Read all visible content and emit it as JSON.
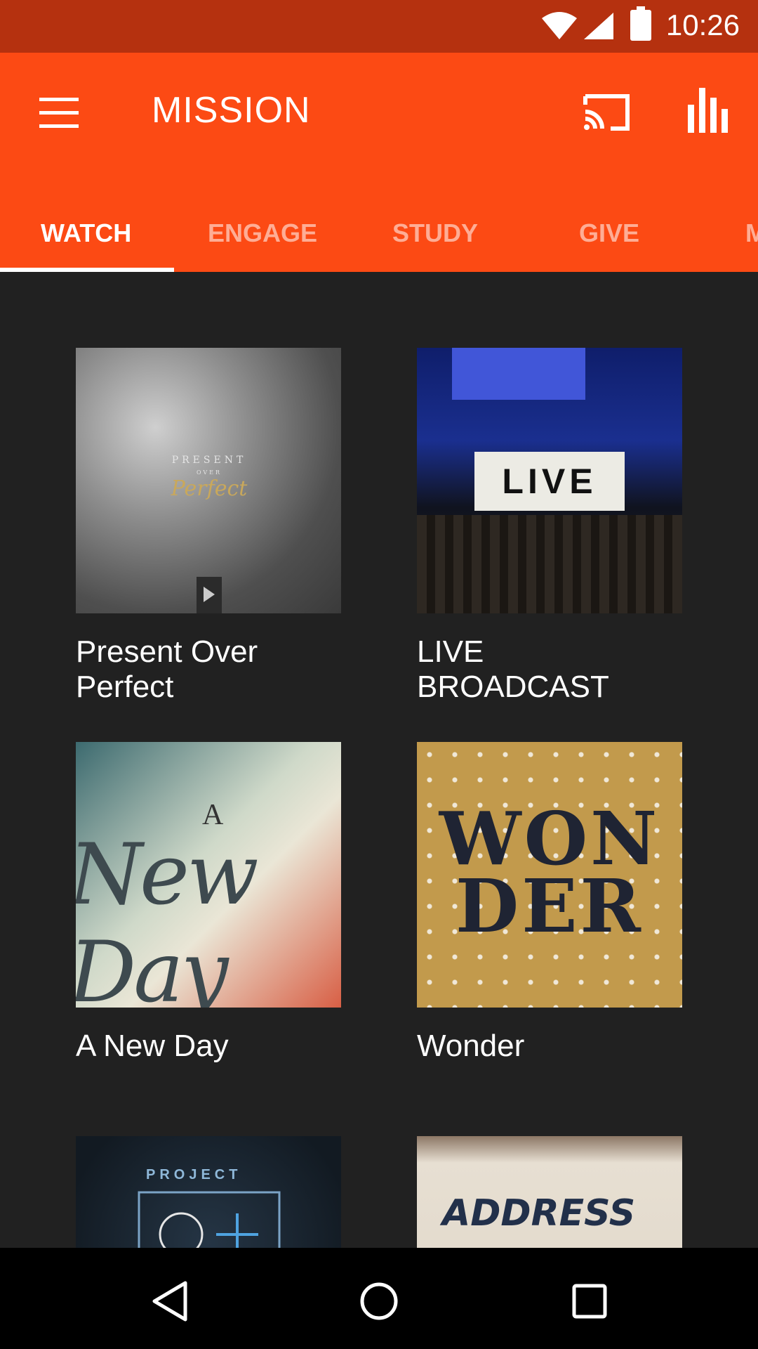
{
  "status_bar": {
    "time": "10:26"
  },
  "app_bar": {
    "title": "MISSION"
  },
  "tabs": [
    {
      "label": "WATCH",
      "active": true
    },
    {
      "label": "ENGAGE",
      "active": false
    },
    {
      "label": "STUDY",
      "active": false
    },
    {
      "label": "GIVE",
      "active": false
    },
    {
      "label": "M",
      "active": false
    }
  ],
  "cards": [
    {
      "title": "Present Over Perfect",
      "thumb_text": [
        "PRESENT",
        "OVER",
        "Perfect"
      ]
    },
    {
      "title": "LIVE BROADCAST",
      "thumb_text": [
        "LIVE"
      ]
    },
    {
      "title": "A New Day",
      "thumb_text": [
        "A",
        "New Day"
      ]
    },
    {
      "title": "Wonder",
      "thumb_text": [
        "WON",
        "DER"
      ]
    },
    {
      "title": "",
      "thumb_text": [
        "PROJECT"
      ]
    },
    {
      "title": "",
      "thumb_text": [
        "ADDRESS"
      ]
    }
  ],
  "colors": {
    "status_bar": "#B5310F",
    "app_bar": "#FC4A14",
    "background": "#212121",
    "nav_bar": "#000000"
  },
  "icons": [
    "wifi-icon",
    "signal-icon",
    "battery-icon",
    "menu-icon",
    "cast-icon",
    "stats-icon",
    "back-icon",
    "home-icon",
    "recents-icon"
  ]
}
